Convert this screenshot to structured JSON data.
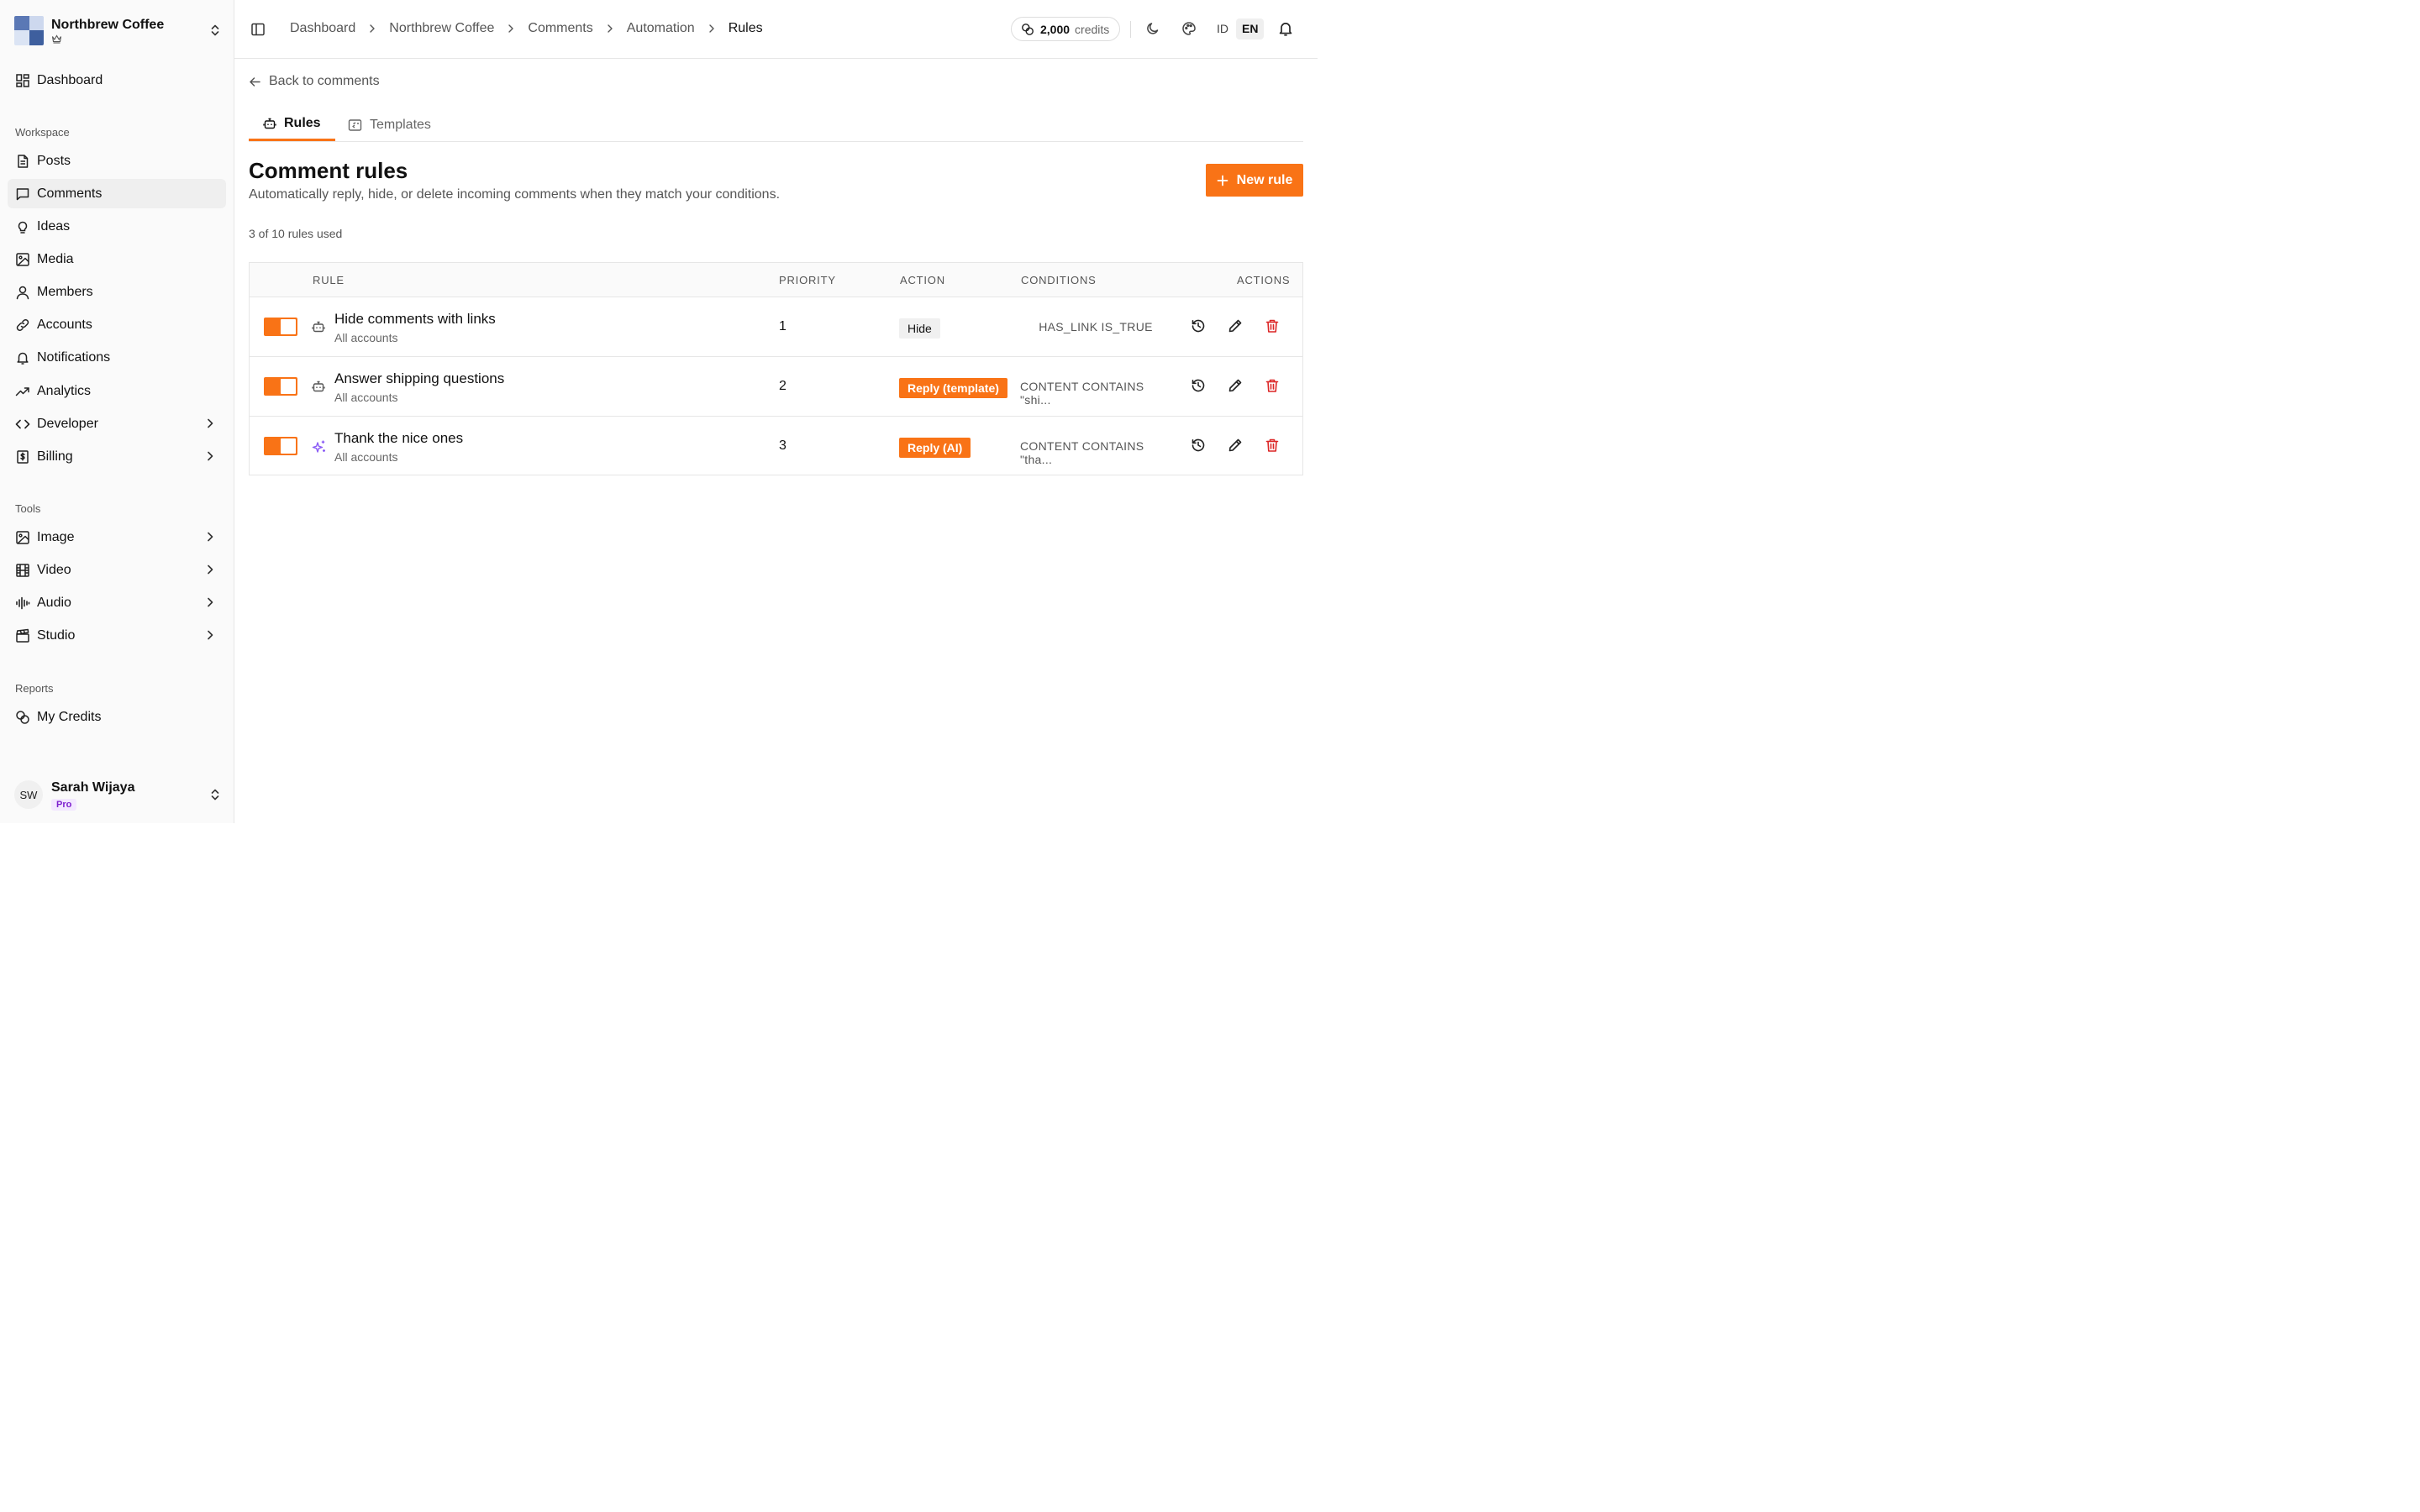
{
  "org": {
    "name": "Northbrew Coffee",
    "crown_icon": "crown-icon",
    "switch_icon": "chevrons-up-down-icon"
  },
  "sidebar": {
    "top": [
      {
        "label": "Dashboard",
        "icon": "dashboard-icon"
      }
    ],
    "workspace_label": "Workspace",
    "workspace": [
      {
        "label": "Posts",
        "icon": "document-icon"
      },
      {
        "label": "Comments",
        "icon": "message-square-icon",
        "active": true
      },
      {
        "label": "Ideas",
        "icon": "lightbulb-icon"
      },
      {
        "label": "Media",
        "icon": "image-icon"
      },
      {
        "label": "Members",
        "icon": "user-icon"
      },
      {
        "label": "Accounts",
        "icon": "link-icon"
      },
      {
        "label": "Notifications",
        "icon": "bell-icon"
      },
      {
        "label": "Analytics",
        "icon": "trending-up-icon"
      },
      {
        "label": "Developer",
        "icon": "code-icon",
        "expandable": true
      },
      {
        "label": "Billing",
        "icon": "dollar-file-icon",
        "expandable": true
      }
    ],
    "tools_label": "Tools",
    "tools": [
      {
        "label": "Image",
        "icon": "image-icon",
        "expandable": true
      },
      {
        "label": "Video",
        "icon": "film-icon",
        "expandable": true
      },
      {
        "label": "Audio",
        "icon": "audio-wave-icon",
        "expandable": true
      },
      {
        "label": "Studio",
        "icon": "clapperboard-icon",
        "expandable": true
      }
    ],
    "reports_label": "Reports",
    "reports": [
      {
        "label": "My Credits",
        "icon": "coins-icon"
      }
    ]
  },
  "user": {
    "initials": "SW",
    "name": "Sarah Wijaya",
    "plan": "Pro"
  },
  "breadcrumb": [
    "Dashboard",
    "Northbrew Coffee",
    "Comments",
    "Automation",
    "Rules"
  ],
  "credits": {
    "amount": "2,000",
    "label": "credits"
  },
  "languages": [
    {
      "code": "ID",
      "active": false
    },
    {
      "code": "EN",
      "active": true
    }
  ],
  "back_label": "Back to comments",
  "tabs": [
    {
      "label": "Rules",
      "icon": "bot-icon",
      "active": true
    },
    {
      "label": "Templates",
      "icon": "template-icon",
      "active": false
    }
  ],
  "page": {
    "title": "Comment rules",
    "subtitle": "Automatically reply, hide, or delete incoming comments when they match your conditions.",
    "new_rule_label": "New rule",
    "usage": "3 of 10 rules used"
  },
  "table": {
    "headers": {
      "rule": "RULE",
      "priority": "PRIORITY",
      "action": "ACTION",
      "conditions": "CONDITIONS",
      "actions": "ACTIONS"
    },
    "rows": [
      {
        "enabled": true,
        "icon": "bot-icon",
        "name": "Hide comments with links",
        "scope": "All accounts",
        "priority": "1",
        "action": "Hide",
        "action_style": "neutral",
        "conditions": "HAS_LINK IS_TRUE"
      },
      {
        "enabled": true,
        "icon": "bot-icon",
        "name": "Answer shipping questions",
        "scope": "All accounts",
        "priority": "2",
        "action": "Reply (template)",
        "action_style": "accent",
        "conditions": "CONTENT CONTAINS \"shi..."
      },
      {
        "enabled": true,
        "icon": "sparkles-icon",
        "name": "Thank the nice ones",
        "scope": "All accounts",
        "priority": "3",
        "action": "Reply (AI)",
        "action_style": "accent",
        "conditions": "CONTENT CONTAINS \"tha..."
      }
    ]
  },
  "colors": {
    "accent": "#f97316",
    "danger": "#dc2626",
    "ai": "#8b5cf6",
    "pro_badge": "#7e22ce"
  }
}
